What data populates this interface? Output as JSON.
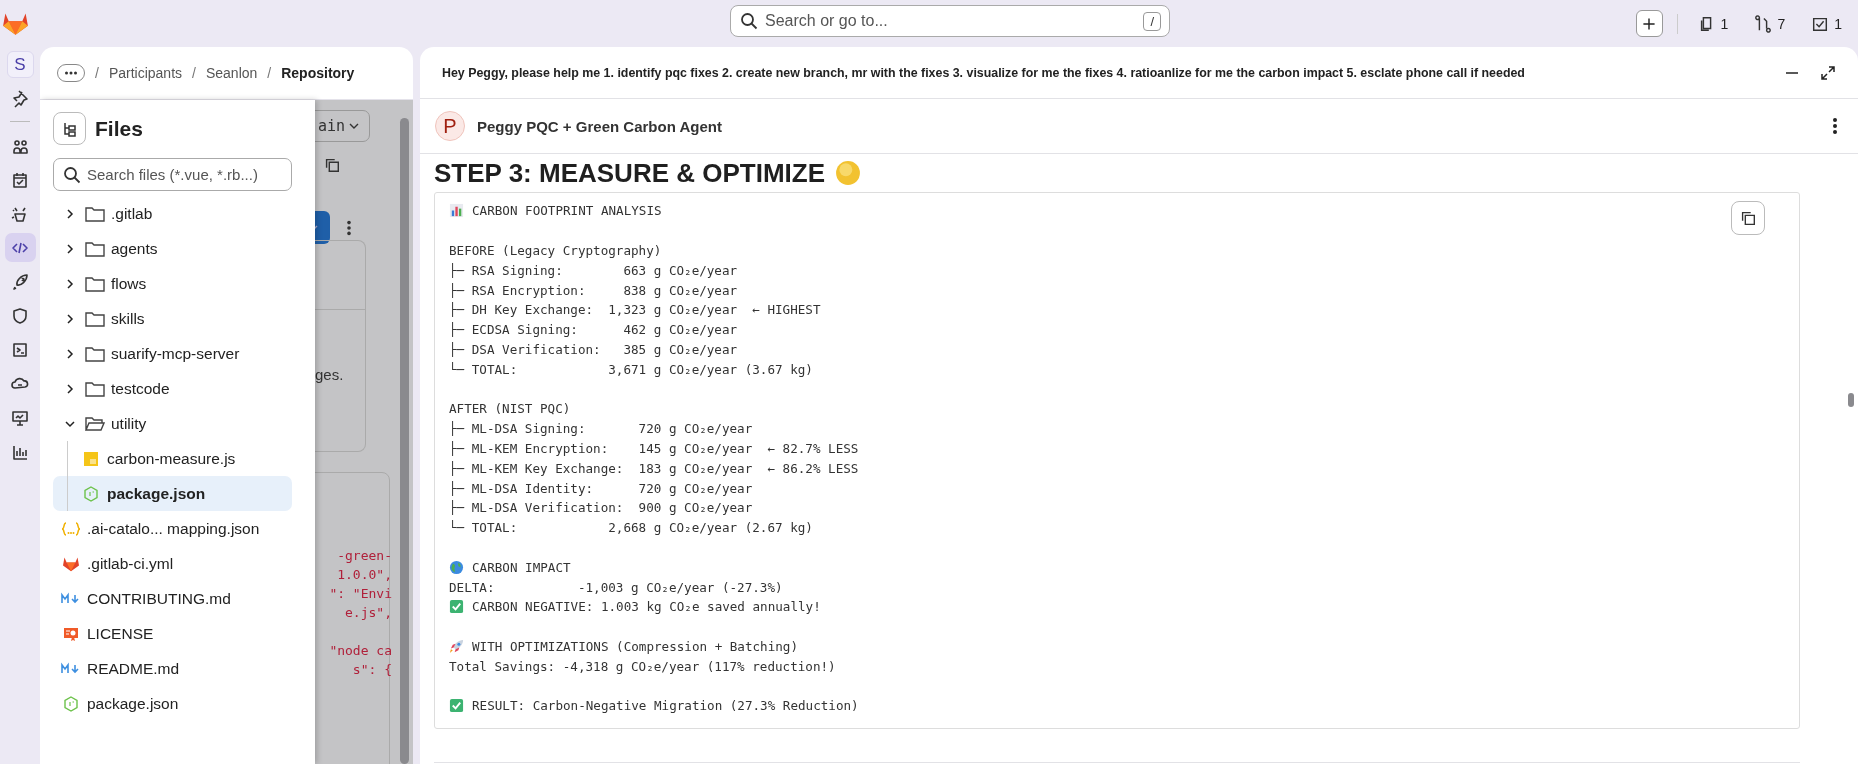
{
  "topbar": {
    "search_placeholder": "Search or go to...",
    "shortcut": "/",
    "counters": [
      {
        "count": "1"
      },
      {
        "count": "7"
      },
      {
        "count": "1"
      }
    ]
  },
  "rail": {
    "avatar": "S",
    "items": [
      {
        "selected": false
      },
      {
        "selected": false
      },
      {
        "selected": false
      },
      {
        "selected": false
      },
      {
        "selected": true
      },
      {
        "selected": false
      },
      {
        "selected": false
      },
      {
        "selected": false
      },
      {
        "selected": false
      },
      {
        "selected": false
      },
      {
        "selected": false
      }
    ]
  },
  "breadcrumb": [
    {
      "separator": "/",
      "label": "Participants"
    },
    {
      "separator": "/",
      "label": "Seanlon"
    },
    {
      "separator": "/",
      "label": "Repository"
    }
  ],
  "files": {
    "title": "Files",
    "search_placeholder": "Search files (*.vue, *.rb...)",
    "tree": [
      {
        "name": ".gitlab",
        "kind": "folder",
        "expanded": false,
        "selected": false
      },
      {
        "name": "agents",
        "kind": "folder",
        "expanded": false,
        "selected": false
      },
      {
        "name": "flows",
        "kind": "folder",
        "expanded": false,
        "selected": false
      },
      {
        "name": "skills",
        "kind": "folder",
        "expanded": false,
        "selected": false
      },
      {
        "name": "suarify-mcp-server",
        "kind": "folder",
        "expanded": false,
        "selected": false
      },
      {
        "name": "testcode",
        "kind": "folder",
        "expanded": false,
        "selected": false
      },
      {
        "name": "utility",
        "kind": "folder",
        "expanded": true,
        "selected": false,
        "children": [
          {
            "name": "carbon-measure.js",
            "kind": "js",
            "selected": false
          },
          {
            "name": "package.json",
            "kind": "node",
            "selected": true
          }
        ]
      },
      {
        "name": ".ai-catalo... mapping.json",
        "kind": "braces",
        "selected": false
      },
      {
        "name": ".gitlab-ci.yml",
        "kind": "gitlab",
        "selected": false
      },
      {
        "name": "CONTRIBUTING.md",
        "kind": "markdown",
        "selected": false
      },
      {
        "name": "LICENSE",
        "kind": "license",
        "selected": false
      },
      {
        "name": "README.md",
        "kind": "markdown",
        "selected": false
      },
      {
        "name": "package.json",
        "kind": "node",
        "selected": false
      }
    ]
  },
  "behind": {
    "branch": "ain",
    "snippet": "ges.",
    "code_lines": [
      "-green-",
      "1.0.0\",",
      "\": \"Envi",
      "e.js\",",
      "\"node ca",
      "s\": {"
    ]
  },
  "chat": {
    "prompt": "Hey Peggy, please help me 1. identify pqc fixes 2. create new branch, mr with the fixes 3. visualize for me the fixes 4. ratioanlize for me the carbon impact 5. esclate phone call if needed",
    "agent_initial": "P",
    "agent_name": "Peggy PQC + Green Carbon Agent",
    "heading": "STEP 3: MEASURE & OPTIMIZE",
    "analysis": [
      [
        {
          "kind": "chart",
          "text": "CARBON FOOTPRINT ANALYSIS"
        }
      ],
      [
        {
          "text": "BEFORE (Legacy Cryptography)"
        },
        {
          "text": "├─ RSA Signing:        663 g CO₂e/year"
        },
        {
          "text": "├─ RSA Encryption:     838 g CO₂e/year"
        },
        {
          "text": "├─ DH Key Exchange:  1,323 g CO₂e/year  ← HIGHEST"
        },
        {
          "text": "├─ ECDSA Signing:      462 g CO₂e/year"
        },
        {
          "text": "├─ DSA Verification:   385 g CO₂e/year"
        },
        {
          "text": "└─ TOTAL:            3,671 g CO₂e/year (3.67 kg)"
        }
      ],
      [
        {
          "text": "AFTER (NIST PQC)"
        },
        {
          "text": "├─ ML-DSA Signing:       720 g CO₂e/year"
        },
        {
          "text": "├─ ML-KEM Encryption:    145 g CO₂e/year  ← 82.7% LESS"
        },
        {
          "text": "├─ ML-KEM Key Exchange:  183 g CO₂e/year  ← 86.2% LESS"
        },
        {
          "text": "├─ ML-DSA Identity:      720 g CO₂e/year"
        },
        {
          "text": "├─ ML-DSA Verification:  900 g CO₂e/year"
        },
        {
          "text": "└─ TOTAL:            2,668 g CO₂e/year (2.67 kg)"
        }
      ],
      [
        {
          "kind": "globe",
          "text": "CARBON IMPACT"
        },
        {
          "text": "DELTA:           -1,003 g CO₂e/year (-27.3%)"
        },
        {
          "kind": "check",
          "text": "CARBON NEGATIVE: 1.003 kg CO₂e saved annually!"
        }
      ],
      [
        {
          "kind": "rocket",
          "text": "WITH OPTIMIZATIONS (Compression + Batching)"
        },
        {
          "text": "Total Savings: -4,318 g CO₂e/year (117% reduction!)"
        }
      ],
      [
        {
          "kind": "check",
          "text": "RESULT: Carbon-Negative Migration (27.3% Reduction)"
        }
      ]
    ]
  }
}
